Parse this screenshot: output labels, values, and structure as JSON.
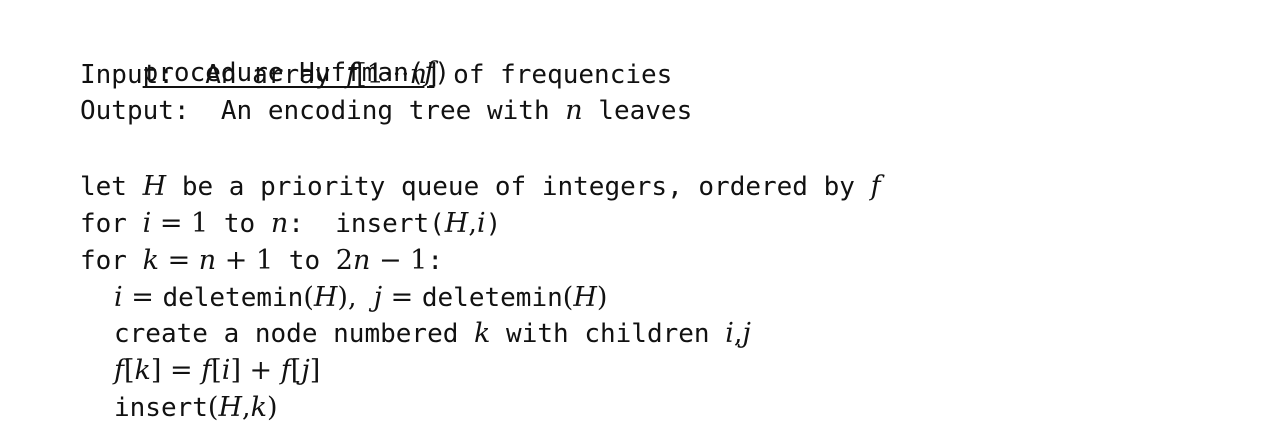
{
  "l1": {
    "kw": "procedure Huffman(",
    "var": "f",
    "close": ")"
  },
  "l2": {
    "lab": "Input:  An array ",
    "f": "f",
    "br": "[1",
    "dots": "···",
    "n": "n",
    "br2": "]",
    "rest": " of frequencies"
  },
  "l3": {
    "lab": "Output:  An encoding tree with ",
    "n": "n",
    "rest": " leaves"
  },
  "l4": {
    "a": "let ",
    "H": "H",
    "b": " be a priority queue of integers, ordered by ",
    "f": "f"
  },
  "l5": {
    "a": "for ",
    "i": "i",
    "eq": " = 1",
    "to": " to ",
    "n": "n",
    "b": ":  insert(",
    "H": "H",
    "comma": ",",
    "i2": "i",
    "c": ")"
  },
  "l6": {
    "a": "for ",
    "k": "k",
    "eq": " = ",
    "n": "n",
    "plus": " + 1",
    "to": " to ",
    "two": "2",
    "n2": "n",
    "minus": " − 1",
    "b": ":"
  },
  "l7": {
    "i": "i",
    "eq": " = ",
    "dm": "deletemin",
    "op": "(",
    "H": "H",
    "cl": "),  ",
    "j": "j",
    "eq2": " = ",
    "dm2": "deletemin",
    "op2": "(",
    "H2": "H",
    "cl2": ")"
  },
  "l8": {
    "a": "create a node numbered ",
    "k": "k",
    "b": " with children ",
    "i": "i",
    "comma": ",",
    "j": "j"
  },
  "l9": {
    "f1": "f",
    "b1": "[",
    "k": "k",
    "b2": "] = ",
    "f2": "f",
    "b3": "[",
    "i": "i",
    "b4": "] + ",
    "f3": "f",
    "b5": "[",
    "j": "j",
    "b6": "]"
  },
  "l10": {
    "ins": "insert",
    "op": "(",
    "H": "H",
    "comma": ",",
    "k": "k",
    "cl": ")"
  }
}
